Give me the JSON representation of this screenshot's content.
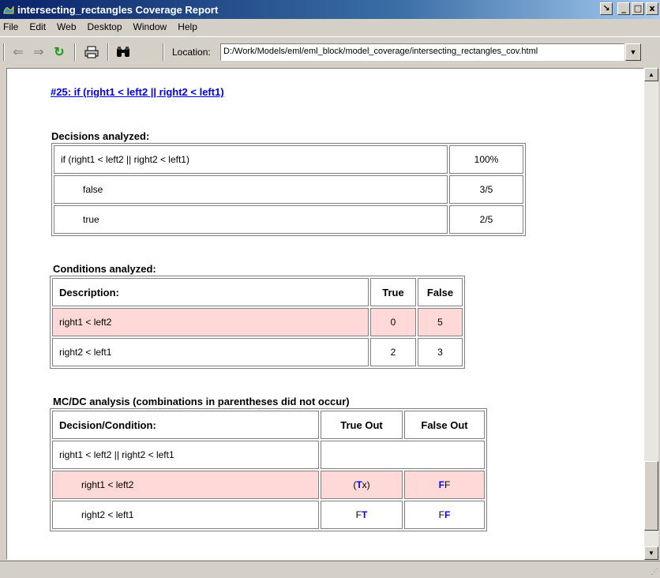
{
  "window": {
    "title": "intersecting_rectangles Coverage Report"
  },
  "menu": [
    "File",
    "Edit",
    "Web",
    "Desktop",
    "Window",
    "Help"
  ],
  "toolbar": {
    "location_label": "Location:",
    "location_value": "D:/Work/Models/eml/eml_block/model_coverage/intersecting_rectangles_cov.html"
  },
  "report": {
    "link": "#25: if (right1 < left2 || right2 < left1)",
    "decisions": {
      "heading": "Decisions analyzed:",
      "rows": [
        {
          "label": "if (right1 < left2 || right2 < left1)",
          "value": "100%"
        },
        {
          "label": "false",
          "value": "3/5"
        },
        {
          "label": "true",
          "value": "2/5"
        }
      ]
    },
    "conditions": {
      "heading": "Conditions analyzed:",
      "headers": [
        "Description:",
        "True",
        "False"
      ],
      "rows": [
        {
          "desc": "right1 < left2",
          "true": "0",
          "false": "5",
          "missed": true
        },
        {
          "desc": "right2 < left1",
          "true": "2",
          "false": "3",
          "missed": false
        }
      ]
    },
    "mcdc": {
      "heading": "MC/DC analysis (combinations in parentheses did not occur)",
      "headers": [
        "Decision/Condition:",
        "True Out",
        "False Out"
      ],
      "decision_row": "right1 < left2 || right2 < left1",
      "rows": [
        {
          "cond": "right1 < left2",
          "missed": true,
          "true_out": {
            "pre": "(",
            "hl": "T",
            "post": "x)"
          },
          "false_out": {
            "pre": "",
            "hl": "F",
            "post": "F"
          }
        },
        {
          "cond": "right2 < left1",
          "missed": false,
          "true_out": {
            "pre": "F",
            "hl": "T",
            "post": ""
          },
          "false_out": {
            "pre": "F",
            "hl": "F",
            "post": ""
          }
        }
      ]
    }
  },
  "icons": [
    "back-arrow-icon",
    "forward-arrow-icon",
    "refresh-icon",
    "print-icon",
    "find-icon"
  ],
  "colors": {
    "missed_row": "#ffd8d8",
    "highlight_letter": "#0000ff",
    "link": "#0000ee"
  }
}
